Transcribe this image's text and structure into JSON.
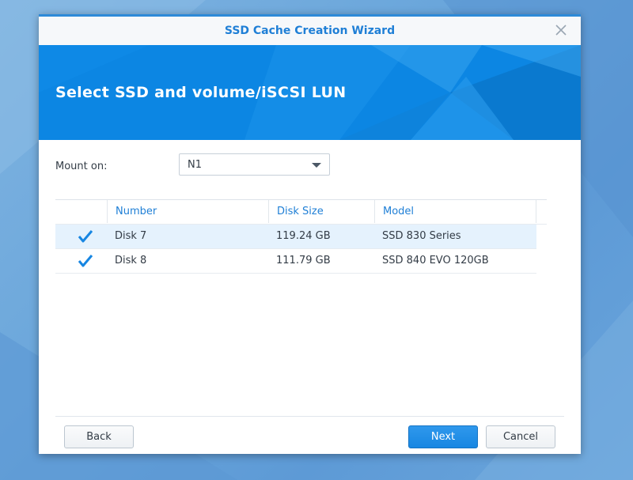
{
  "dialog": {
    "title": "SSD Cache Creation Wizard",
    "close_icon": "close-icon",
    "accent_color": "#1f7fd6"
  },
  "banner": {
    "heading": "Select SSD and volume/iSCSI LUN",
    "color": "#0c86e3"
  },
  "mount": {
    "label": "Mount on:",
    "selected": "N1",
    "arrow_icon": "chevron-down-icon"
  },
  "table": {
    "columns": [
      "Number",
      "Disk Size",
      "Model"
    ],
    "rows": [
      {
        "checked": true,
        "number": "Disk 7",
        "size": "119.24 GB",
        "model": "SSD 830 Series",
        "selected": true
      },
      {
        "checked": true,
        "number": "Disk 8",
        "size": "111.79 GB",
        "model": "SSD 840 EVO 120GB",
        "selected": false
      }
    ],
    "check_icon": "checkmark-icon"
  },
  "buttons": {
    "back": "Back",
    "next": "Next",
    "cancel": "Cancel"
  }
}
